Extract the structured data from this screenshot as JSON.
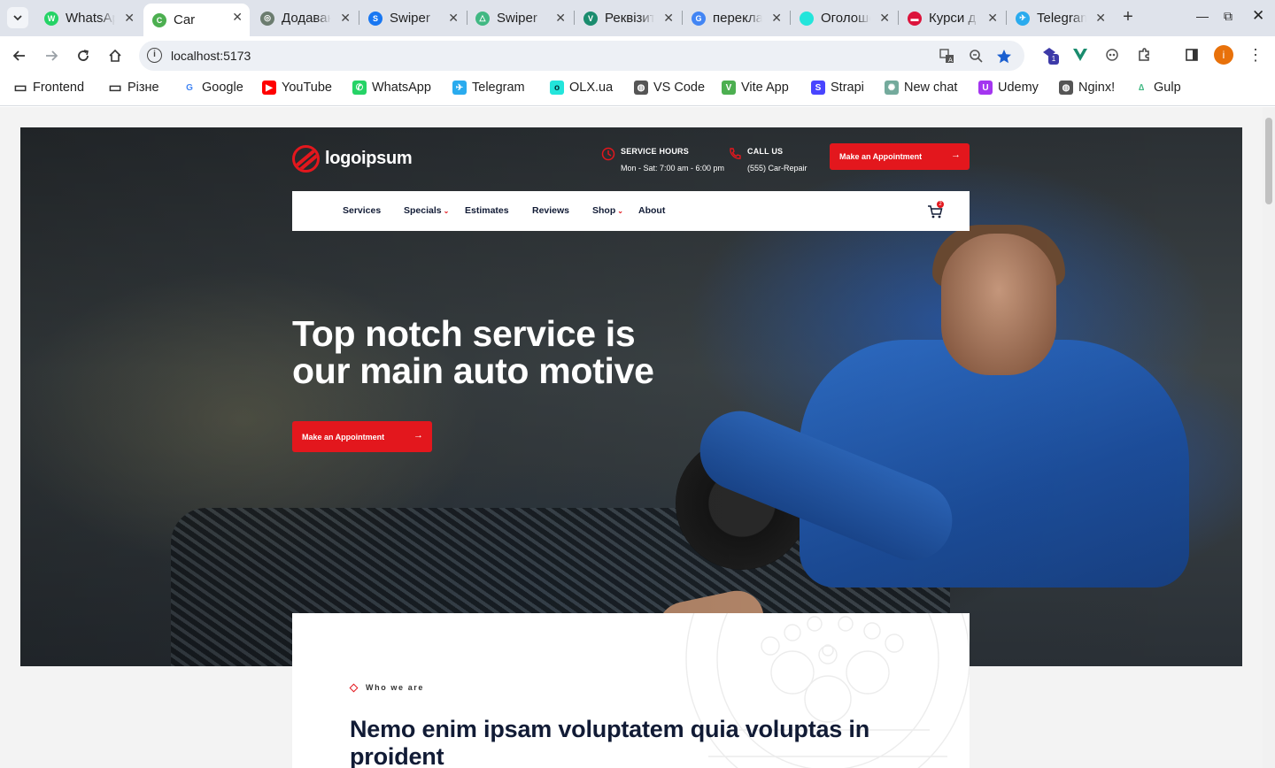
{
  "browser": {
    "tabs": [
      {
        "label": "WhatsApp",
        "color": "#25d366",
        "glyph": "W"
      },
      {
        "label": "Car",
        "color": "#4caf50",
        "glyph": "C",
        "active": true
      },
      {
        "label": "Додавання",
        "color": "#6b7c6f",
        "glyph": "◎"
      },
      {
        "label": "Swiper",
        "color": "#1877f2",
        "glyph": "S"
      },
      {
        "label": "Swiper",
        "color": "#41b883",
        "glyph": "△"
      },
      {
        "label": "Реквізити",
        "color": "#1a8c6e",
        "glyph": "V"
      },
      {
        "label": "переклад",
        "color": "#4285f4",
        "glyph": "G"
      },
      {
        "label": "Оголошення",
        "color": "#23e5db",
        "glyph": "olx"
      },
      {
        "label": "Курси д",
        "color": "#dc143c",
        "glyph": "▬"
      },
      {
        "label": "Telegram",
        "color": "#2aabee",
        "glyph": "✈"
      }
    ],
    "url": "localhost:5173",
    "bookmarks": [
      {
        "label": "Frontend",
        "icon": "folder-icon"
      },
      {
        "label": "Різне",
        "icon": "folder-icon"
      },
      {
        "label": "Google",
        "icon": "google-icon"
      },
      {
        "label": "YouTube",
        "icon": "youtube-icon"
      },
      {
        "label": "WhatsApp",
        "icon": "whatsapp-icon"
      },
      {
        "label": "Telegram",
        "icon": "telegram-icon"
      },
      {
        "label": "OLX.ua",
        "icon": "olx-icon"
      },
      {
        "label": "VS Code",
        "icon": "globe-icon"
      },
      {
        "label": "Vite App",
        "icon": "vite-icon"
      },
      {
        "label": "Strapi",
        "icon": "strapi-icon"
      },
      {
        "label": "New chat",
        "icon": "openai-icon"
      },
      {
        "label": "Udemy",
        "icon": "udemy-icon"
      },
      {
        "label": "Nginx!",
        "icon": "globe-icon"
      },
      {
        "label": "Gulp",
        "icon": "vue-icon"
      }
    ],
    "profile_initial": "i",
    "extension_badge": "1"
  },
  "site": {
    "logo_text": "logoipsum",
    "service_hours": {
      "label": "SERVICE HOURS",
      "value": "Mon - Sat: 7:00 am - 6:00 pm"
    },
    "call_us": {
      "label": "CALL US",
      "value": "(555) Car-Repair"
    },
    "cta_top": "Make an Appointment",
    "nav": [
      {
        "label": "Services",
        "dropdown": false
      },
      {
        "label": "Specials",
        "dropdown": true
      },
      {
        "label": "Estimates",
        "dropdown": false
      },
      {
        "label": "Reviews",
        "dropdown": false
      },
      {
        "label": "Shop",
        "dropdown": true
      },
      {
        "label": "About",
        "dropdown": false
      }
    ],
    "cart_count": "2",
    "hero": {
      "title": "Top notch service is our main auto motive",
      "cta": "Make an Appointment"
    },
    "about": {
      "tag": "Who we are",
      "title": "Nemo enim ipsam voluptatem quia voluptas in proident"
    }
  },
  "colors": {
    "accent": "#e3171d",
    "navy": "#111b35"
  }
}
